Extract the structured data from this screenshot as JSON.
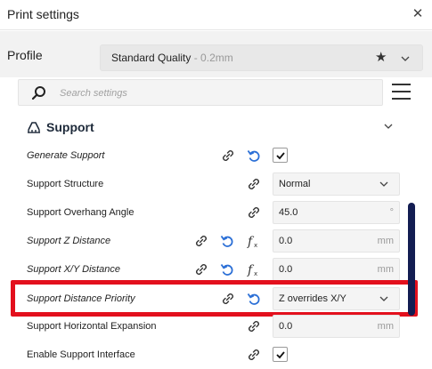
{
  "window": {
    "title": "Print settings"
  },
  "profile": {
    "label": "Profile",
    "name": "Standard Quality",
    "sub": " - 0.2mm"
  },
  "search": {
    "placeholder": "Search settings"
  },
  "section": {
    "label": "Support"
  },
  "rows": [
    {
      "label": "Generate Support",
      "value": "checked"
    },
    {
      "label": "Support Structure",
      "value": "Normal"
    },
    {
      "label": "Support Overhang Angle",
      "value": "45.0",
      "unit": "°"
    },
    {
      "label": "Support Z Distance",
      "value": "0.0",
      "unit": "mm"
    },
    {
      "label": "Support X/Y Distance",
      "value": "0.0",
      "unit": "mm"
    },
    {
      "label": "Support Distance Priority",
      "value": "Z overrides X/Y"
    },
    {
      "label": "Support Horizontal Expansion",
      "value": "0.0",
      "unit": "mm"
    },
    {
      "label": "Enable Support Interface",
      "value": "checked"
    }
  ],
  "colors": {
    "highlight": "#e3101d",
    "reset_icon": "#2b6fd6",
    "scrollbar": "#131d52"
  }
}
